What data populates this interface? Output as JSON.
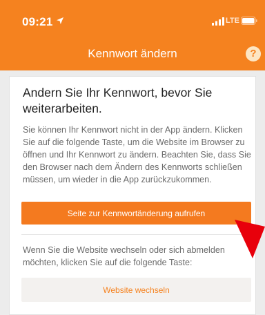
{
  "status_bar": {
    "time": "09:21",
    "network": "LTE"
  },
  "header": {
    "title": "Kennwort ändern",
    "help_label": "?"
  },
  "card": {
    "heading": "Andern Sie Ihr Kennwort, bevor Sie weiterarbeiten.",
    "body": "Sie können Ihr Kennwort nicht in der App ändern. Klicken Sie auf die folgende Taste, um die Website im Browser zu öffnen und Ihr Kennwort zu ändern. Beachten Sie, dass Sie den Browser nach dem Ändern des Kennworts schließen müssen, um wieder in die App zurückzukommen.",
    "primary_button": "Seite zur Kennwortänderung aufrufen",
    "note": "Wenn Sie die Website wechseln oder sich abmelden möchten, klicken Sie auf die folgende Taste:",
    "secondary_button": "Website wechseln"
  },
  "colors": {
    "accent": "#f5821f",
    "annotation_arrow": "#e8000b"
  },
  "icons": {
    "location": "location-arrow-icon",
    "signal": "signal-icon",
    "battery": "battery-icon",
    "help": "help-icon",
    "pointer": "red-pointer-arrow"
  }
}
